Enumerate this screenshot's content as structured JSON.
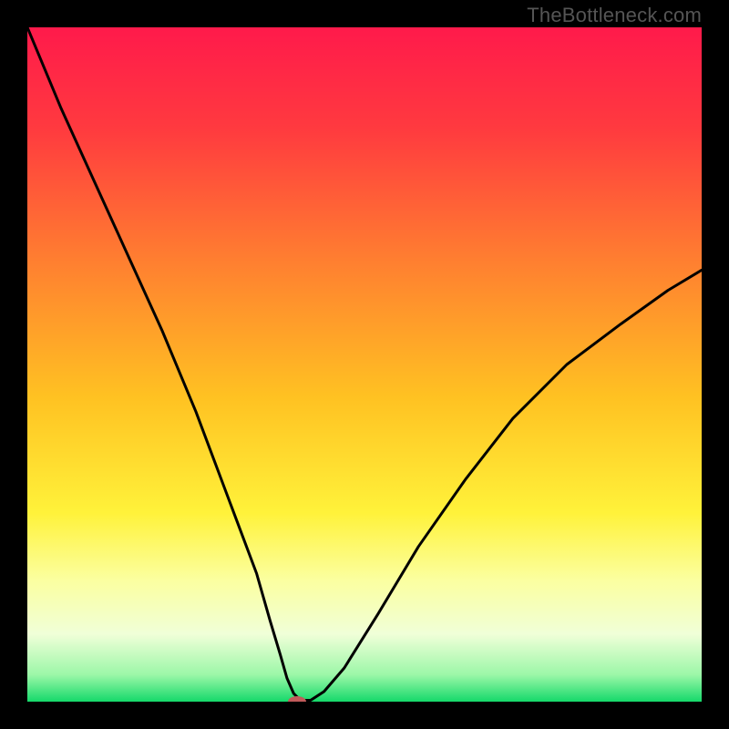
{
  "watermark": "TheBottleneck.com",
  "chart_data": {
    "type": "line",
    "title": "",
    "xlabel": "",
    "ylabel": "",
    "xlim": [
      0,
      100
    ],
    "ylim": [
      0,
      100
    ],
    "background_gradient": {
      "stops": [
        {
          "offset": 0.0,
          "color": "#ff1a4b"
        },
        {
          "offset": 0.15,
          "color": "#ff3a3f"
        },
        {
          "offset": 0.35,
          "color": "#ff8030"
        },
        {
          "offset": 0.55,
          "color": "#ffc222"
        },
        {
          "offset": 0.72,
          "color": "#fff23a"
        },
        {
          "offset": 0.82,
          "color": "#fbffa0"
        },
        {
          "offset": 0.9,
          "color": "#f0ffd8"
        },
        {
          "offset": 0.96,
          "color": "#9cf7a8"
        },
        {
          "offset": 1.0,
          "color": "#15d96a"
        }
      ]
    },
    "series": [
      {
        "name": "bottleneck-curve",
        "x": [
          0,
          5,
          10,
          15,
          20,
          25,
          28,
          31,
          34,
          36,
          37.5,
          38.5,
          39.5,
          40.5,
          42,
          44,
          47,
          52,
          58,
          65,
          72,
          80,
          88,
          95,
          100
        ],
        "y": [
          100,
          88,
          77,
          66,
          55,
          43,
          35,
          27,
          19,
          12,
          7,
          3.5,
          1.2,
          0.2,
          0.2,
          1.5,
          5,
          13,
          23,
          33,
          42,
          50,
          56,
          61,
          64
        ]
      }
    ],
    "marker": {
      "name": "optimum-marker",
      "x": 40,
      "y": 0,
      "color": "#c05a5a",
      "rx": 10,
      "ry": 6
    }
  }
}
